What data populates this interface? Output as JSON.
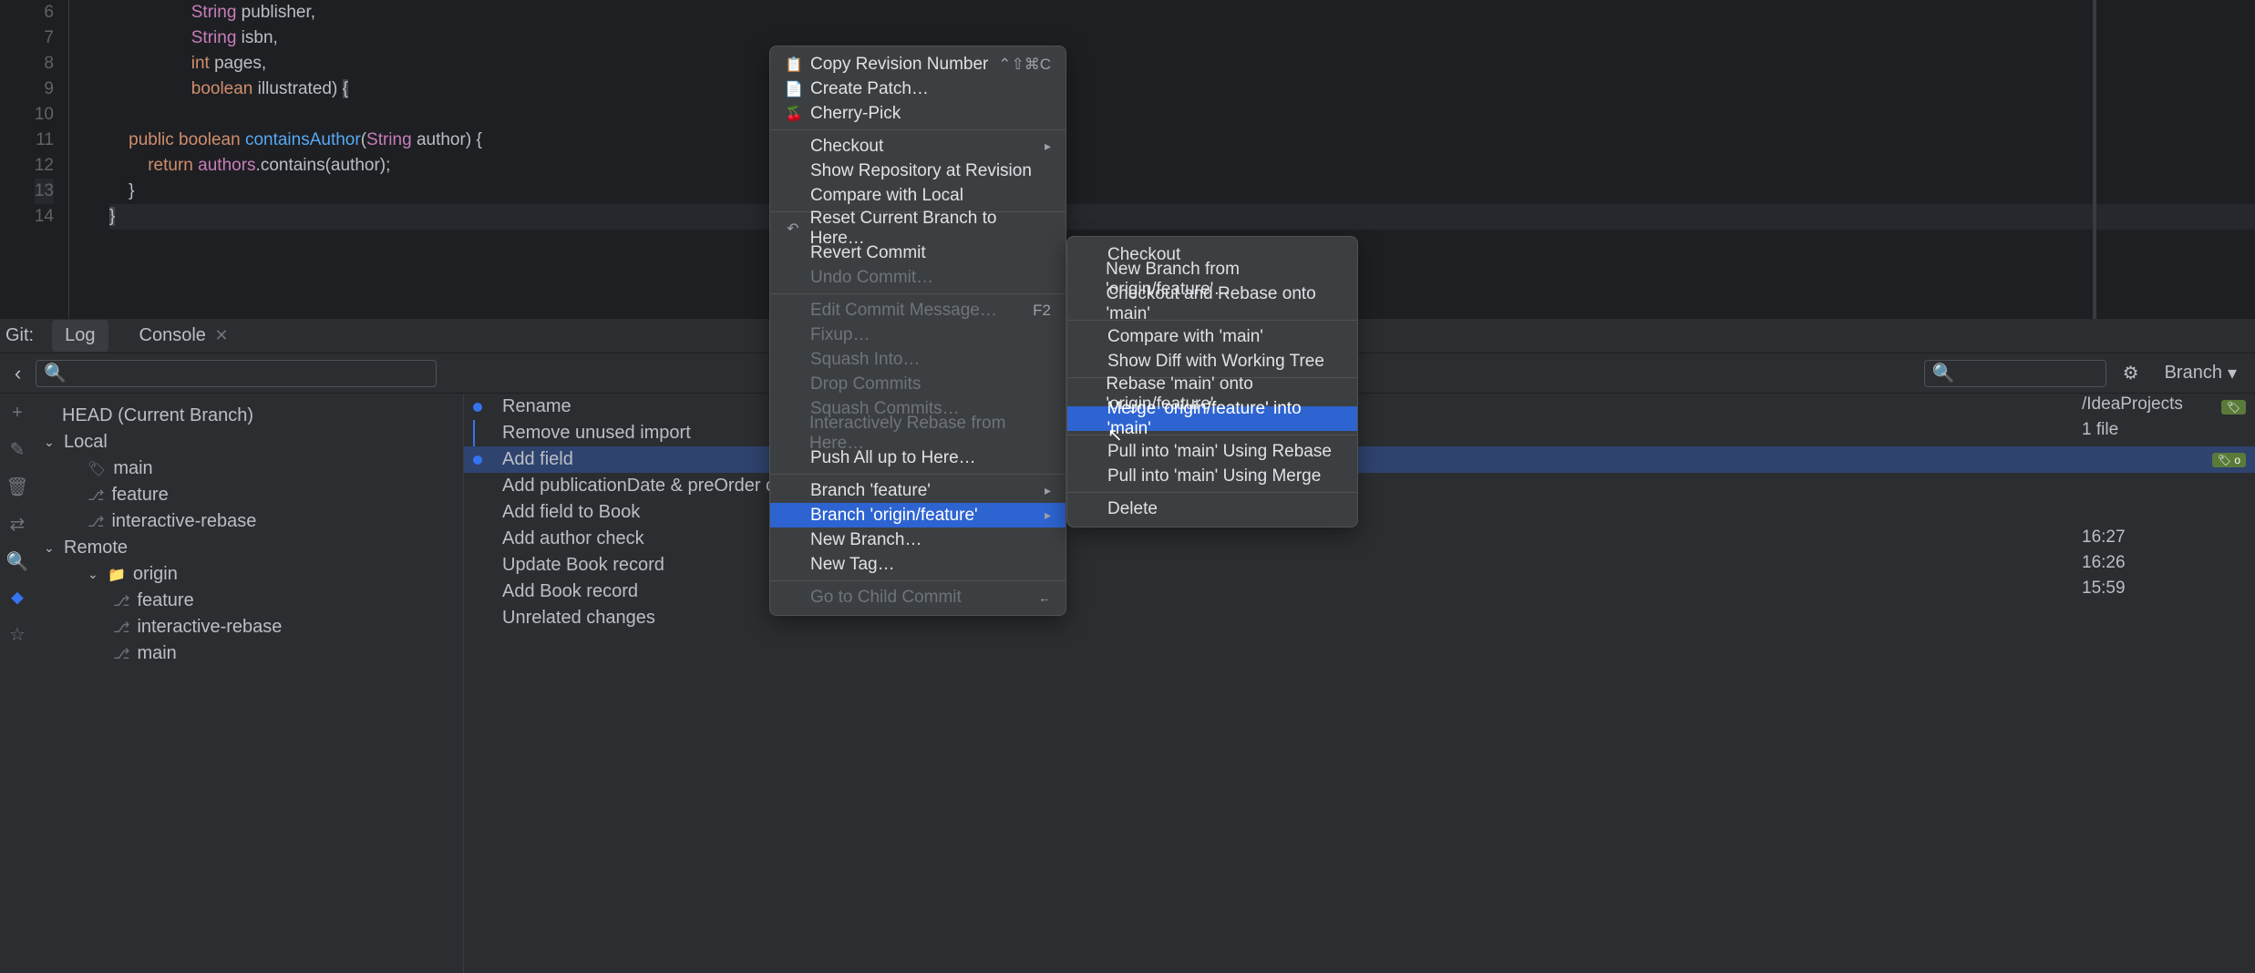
{
  "code_lines": [
    {
      "n": "",
      "t": "                                String publisher,"
    },
    {
      "n": "6",
      "t": "                                String isbn,"
    },
    {
      "n": "7",
      "t": "                                int pages,"
    },
    {
      "n": "8",
      "t": "                                boolean illustrated) {"
    },
    {
      "n": "9",
      "t": ""
    },
    {
      "n": "10",
      "t": "            public boolean containsAuthor(String author) {"
    },
    {
      "n": "11",
      "t": "                return authors.contains(author);"
    },
    {
      "n": "12",
      "t": "            }"
    },
    {
      "n": "13",
      "t": "        }"
    },
    {
      "n": "14",
      "t": ""
    }
  ],
  "git_tabs": {
    "label": "Git:",
    "log": "Log",
    "console": "Console"
  },
  "toolbar": {
    "branch_label": "Branch"
  },
  "branches": {
    "head": "HEAD (Current Branch)",
    "local_label": "Local",
    "local": [
      "main",
      "feature",
      "interactive-rebase"
    ],
    "remote_label": "Remote",
    "origin_label": "origin",
    "remote": [
      "feature",
      "interactive-rebase",
      "main"
    ]
  },
  "commits": [
    {
      "msg": "Rename",
      "tag": true
    },
    {
      "msg": "Remove unused import"
    },
    {
      "msg": "Add field",
      "tag": true,
      "selected": true,
      "tagtext": "o"
    },
    {
      "msg": "Add publicationDate & preOrder check"
    },
    {
      "msg": "Add field to Book"
    },
    {
      "msg": "Add author check"
    },
    {
      "msg": "Update Book record"
    },
    {
      "msg": "Add Book record"
    },
    {
      "msg": "Unrelated changes"
    }
  ],
  "right_panel": {
    "path": "/IdeaProjects",
    "files": "1 file",
    "times": [
      "16:27",
      "16:26",
      "15:59"
    ]
  },
  "menu1": [
    {
      "t": "Copy Revision Number",
      "icon": "📋",
      "sc": "⌃⇧⌘C"
    },
    {
      "t": "Create Patch…",
      "icon": "📄"
    },
    {
      "t": "Cherry-Pick",
      "icon": "🍒"
    },
    {
      "sep": true
    },
    {
      "t": "Checkout",
      "arrow": true
    },
    {
      "t": "Show Repository at Revision"
    },
    {
      "t": "Compare with Local"
    },
    {
      "sep": true
    },
    {
      "t": "Reset Current Branch to Here…",
      "icon": "↶"
    },
    {
      "t": "Revert Commit"
    },
    {
      "t": "Undo Commit…",
      "disabled": true
    },
    {
      "sep": true
    },
    {
      "t": "Edit Commit Message…",
      "disabled": true,
      "sc": "F2"
    },
    {
      "t": "Fixup…",
      "disabled": true
    },
    {
      "t": "Squash Into…",
      "disabled": true
    },
    {
      "t": "Drop Commits",
      "disabled": true
    },
    {
      "t": "Squash Commits…",
      "disabled": true
    },
    {
      "t": "Interactively Rebase from Here…",
      "disabled": true
    },
    {
      "t": "Push All up to Here…"
    },
    {
      "sep": true
    },
    {
      "t": "Branch 'feature'",
      "arrow": true
    },
    {
      "t": "Branch 'origin/feature'",
      "arrow": true,
      "hl": true
    },
    {
      "t": "New Branch…"
    },
    {
      "t": "New Tag…"
    },
    {
      "sep": true
    },
    {
      "t": "Go to Child Commit",
      "disabled": true,
      "arrowleft": true
    }
  ],
  "menu2": [
    {
      "t": "Checkout"
    },
    {
      "t": "New Branch from 'origin/feature'…"
    },
    {
      "t": "Checkout and Rebase onto 'main'"
    },
    {
      "sep": true
    },
    {
      "t": "Compare with 'main'"
    },
    {
      "t": "Show Diff with Working Tree"
    },
    {
      "sep": true
    },
    {
      "t": "Rebase 'main' onto 'origin/feature'"
    },
    {
      "t": "Merge 'origin/feature' into 'main'",
      "hl": true
    },
    {
      "sep": true
    },
    {
      "t": "Pull into 'main' Using Rebase"
    },
    {
      "t": "Pull into 'main' Using Merge"
    },
    {
      "sep": true
    },
    {
      "t": "Delete"
    }
  ]
}
